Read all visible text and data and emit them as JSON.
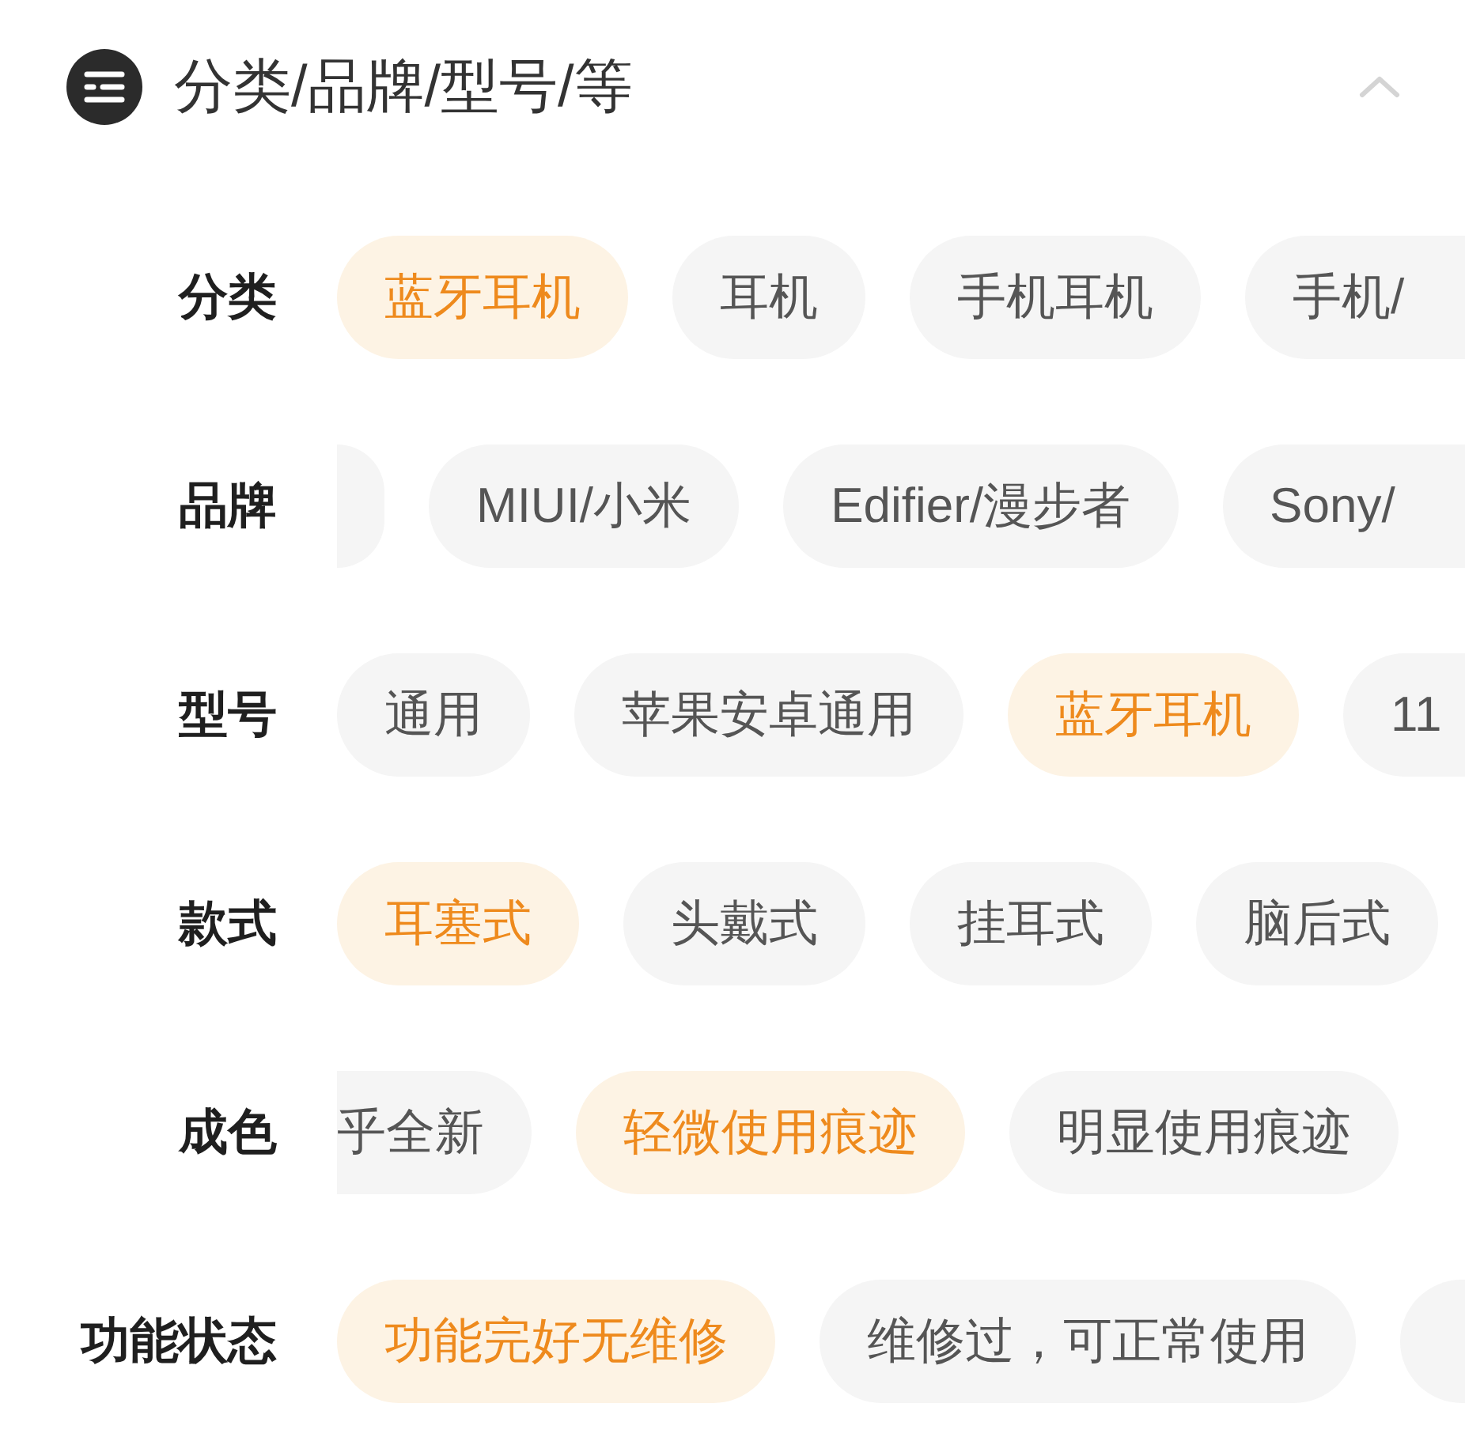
{
  "header": {
    "title": "分类/品牌/型号/等",
    "expanded": true
  },
  "rows": [
    {
      "label": "分类",
      "chips": [
        {
          "kind": "full",
          "label": "蓝牙耳机",
          "selected": true
        },
        {
          "kind": "full",
          "label": "耳机",
          "selected": false
        },
        {
          "kind": "full",
          "label": "手机耳机",
          "selected": false
        },
        {
          "kind": "cut-right",
          "label": "手机/",
          "selected": false
        }
      ]
    },
    {
      "label": "品牌",
      "chips": [
        {
          "kind": "edge-left",
          "selected": false
        },
        {
          "kind": "full",
          "label": "MIUI/小米",
          "selected": false
        },
        {
          "kind": "full",
          "label": "Edifier/漫步者",
          "selected": false
        },
        {
          "kind": "cut-right",
          "label": "Sony/",
          "selected": false
        }
      ]
    },
    {
      "label": "型号",
      "chips": [
        {
          "kind": "full",
          "label": "通用",
          "selected": false
        },
        {
          "kind": "full",
          "label": "苹果安卓通用",
          "selected": false
        },
        {
          "kind": "full",
          "label": "蓝牙耳机",
          "selected": true
        },
        {
          "kind": "cut-right",
          "label": "11",
          "selected": false
        }
      ]
    },
    {
      "label": "款式",
      "chips": [
        {
          "kind": "full",
          "label": "耳塞式",
          "selected": true
        },
        {
          "kind": "full",
          "label": "头戴式",
          "selected": false
        },
        {
          "kind": "full",
          "label": "挂耳式",
          "selected": false
        },
        {
          "kind": "full",
          "label": "脑后式",
          "selected": false
        }
      ]
    },
    {
      "label": "成色",
      "chips": [
        {
          "kind": "cut-left",
          "label": "乎全新",
          "selected": false
        },
        {
          "kind": "full",
          "label": "轻微使用痕迹",
          "selected": true
        },
        {
          "kind": "full",
          "label": "明显使用痕迹",
          "selected": false
        }
      ]
    },
    {
      "label": "功能状态",
      "chips": [
        {
          "kind": "full",
          "label": "功能完好无维修",
          "selected": true
        },
        {
          "kind": "full",
          "label": "维修过，可正常使用",
          "selected": false
        },
        {
          "kind": "edge-right",
          "selected": false
        }
      ]
    }
  ]
}
